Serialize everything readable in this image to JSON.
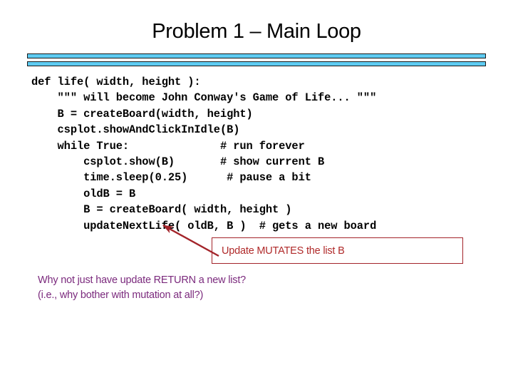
{
  "slide": {
    "title": "Problem 1 – Main Loop",
    "background_color": "#ffffff"
  },
  "dividers": {
    "bar_fill_color": "#5ECBF2",
    "bar_border_color": "#1a1a1a",
    "count": 2
  },
  "code_block": {
    "language": "python",
    "text": "def life( width, height ):\n    \"\"\" will become John Conway's Game of Life... \"\"\"\n    B = createBoard(width, height)\n    csplot.showAndClickInIdle(B)\n    while True:              # run forever\n        csplot.show(B)       # show current B\n        time.sleep(0.25)      # pause a bit\n        oldB = B\n        B = createBoard( width, height )\n        updateNextLife( oldB, B )  # gets a new board",
    "lines": [
      "def life( width, height ):",
      "    \"\"\" will become John Conway's Game of Life... \"\"\"",
      "    B = createBoard(width, height)",
      "    csplot.showAndClickInIdle(B)",
      "    while True:              # run forever",
      "        csplot.show(B)       # show current B",
      "        time.sleep(0.25)      # pause a bit",
      "        oldB = B",
      "        B = createBoard( width, height )",
      "        updateNextLife( oldB, B )  # gets a new board"
    ],
    "text_color": "#000000"
  },
  "callout": {
    "text": "Update MUTATES the list B",
    "border_color": "#A3242A",
    "text_color": "#B02A2A"
  },
  "arrow": {
    "color": "#A3242A",
    "points_to": "updateNextLife"
  },
  "bottom_note": {
    "line1": "Why not just have update RETURN a new list?",
    "line2": "(i.e., why bother with mutation at all?)",
    "text": "Why not just have update RETURN a new list?\n(i.e., why bother with mutation at all?)",
    "text_color": "#7B2A7D"
  }
}
